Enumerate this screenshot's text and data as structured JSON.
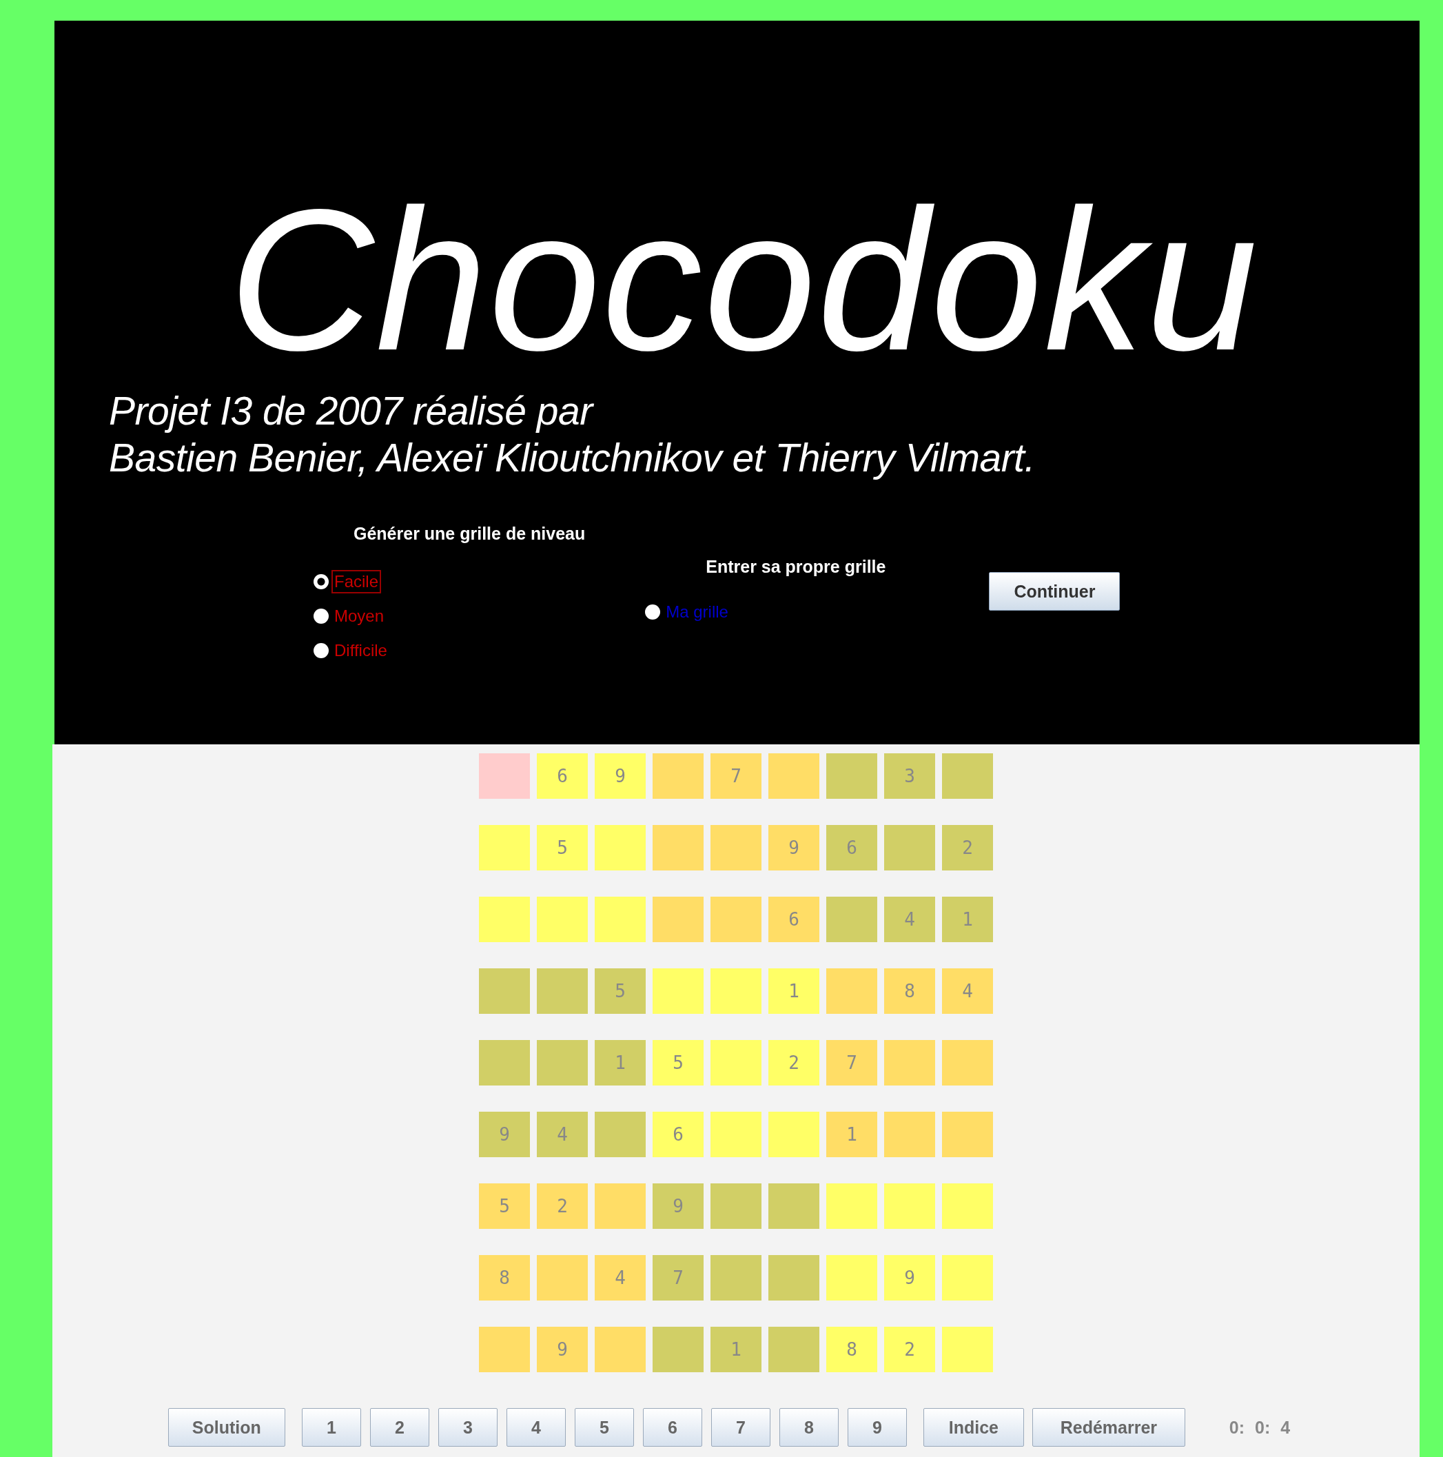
{
  "title": "Chocodoku",
  "credits": [
    "Projet I3 de 2007 réalisé par",
    "Bastien Benier, Alexeï Klioutchnikov et Thierry Vilmart."
  ],
  "generate": {
    "heading": "Générer une grille de niveau",
    "levels": [
      {
        "label": "Facile",
        "selected": true,
        "focused": true
      },
      {
        "label": "Moyen",
        "selected": false,
        "focused": false
      },
      {
        "label": "Difficile",
        "selected": false,
        "focused": false
      }
    ]
  },
  "custom": {
    "heading": "Entrer sa propre grille",
    "option": {
      "label": "Ma grille",
      "selected": false
    }
  },
  "continue_button": "Continuer",
  "grid": {
    "rows": [
      [
        {
          "selected": true
        },
        {
          "value": "6",
          "color": "#ffff66",
          "selected": false
        },
        {
          "value": "9",
          "color": "#ffff66",
          "selected": false
        },
        {
          "color": "#ffdd66",
          "selected": false
        },
        {
          "value": "7",
          "color": "#ffdd66",
          "selected": false
        },
        {
          "color": "#ffdd66",
          "selected": false
        },
        {
          "color": "#d1cf66",
          "selected": false
        },
        {
          "value": "3",
          "color": "#d1cf66",
          "selected": false
        },
        {
          "color": "#d1cf66",
          "selected": false
        }
      ],
      [
        {
          "color": "#ffff66",
          "selected": false
        },
        {
          "value": "5",
          "color": "#ffff66",
          "selected": false
        },
        {
          "color": "#ffff66",
          "selected": false
        },
        {
          "color": "#ffdd66",
          "selected": false
        },
        {
          "color": "#ffdd66",
          "selected": false
        },
        {
          "value": "9",
          "color": "#ffdd66",
          "selected": false
        },
        {
          "value": "6",
          "color": "#d1cf66",
          "selected": false
        },
        {
          "color": "#d1cf66",
          "selected": false
        },
        {
          "value": "2",
          "color": "#d1cf66",
          "selected": false
        }
      ],
      [
        {
          "color": "#ffff66",
          "selected": false
        },
        {
          "color": "#ffff66",
          "selected": false
        },
        {
          "color": "#ffff66",
          "selected": false
        },
        {
          "color": "#ffdd66",
          "selected": false
        },
        {
          "color": "#ffdd66",
          "selected": false
        },
        {
          "value": "6",
          "color": "#ffdd66",
          "selected": false
        },
        {
          "color": "#d1cf66",
          "selected": false
        },
        {
          "value": "4",
          "color": "#d1cf66",
          "selected": false
        },
        {
          "value": "1",
          "color": "#d1cf66",
          "selected": false
        }
      ],
      [
        {
          "color": "#d1cf66",
          "selected": false
        },
        {
          "color": "#d1cf66",
          "selected": false
        },
        {
          "value": "5",
          "color": "#d1cf66",
          "selected": false
        },
        {
          "color": "#ffff66",
          "selected": false
        },
        {
          "color": "#ffff66",
          "selected": false
        },
        {
          "value": "1",
          "color": "#ffff66",
          "selected": false
        },
        {
          "color": "#ffdd66",
          "selected": false
        },
        {
          "value": "8",
          "color": "#ffdd66",
          "selected": false
        },
        {
          "value": "4",
          "color": "#ffdd66",
          "selected": false
        }
      ],
      [
        {
          "color": "#d1cf66",
          "selected": false
        },
        {
          "color": "#d1cf66",
          "selected": false
        },
        {
          "value": "1",
          "color": "#d1cf66",
          "selected": false
        },
        {
          "value": "5",
          "color": "#ffff66",
          "selected": false
        },
        {
          "color": "#ffff66",
          "selected": false
        },
        {
          "value": "2",
          "color": "#ffff66",
          "selected": false
        },
        {
          "value": "7",
          "color": "#ffdd66",
          "selected": false
        },
        {
          "color": "#ffdd66",
          "selected": false
        },
        {
          "color": "#ffdd66",
          "selected": false
        }
      ],
      [
        {
          "value": "9",
          "color": "#d1cf66",
          "selected": false
        },
        {
          "value": "4",
          "color": "#d1cf66",
          "selected": false
        },
        {
          "color": "#d1cf66",
          "selected": false
        },
        {
          "value": "6",
          "color": "#ffff66",
          "selected": false
        },
        {
          "color": "#ffff66",
          "selected": false
        },
        {
          "color": "#ffff66",
          "selected": false
        },
        {
          "value": "1",
          "color": "#ffdd66",
          "selected": false
        },
        {
          "color": "#ffdd66",
          "selected": false
        },
        {
          "color": "#ffdd66",
          "selected": false
        }
      ],
      [
        {
          "value": "5",
          "color": "#ffdd66",
          "selected": false
        },
        {
          "value": "2",
          "color": "#ffdd66",
          "selected": false
        },
        {
          "color": "#ffdd66",
          "selected": false
        },
        {
          "value": "9",
          "color": "#d1cf66",
          "selected": false
        },
        {
          "color": "#d1cf66",
          "selected": false
        },
        {
          "color": "#d1cf66",
          "selected": false
        },
        {
          "color": "#ffff66",
          "selected": false
        },
        {
          "color": "#ffff66",
          "selected": false
        },
        {
          "color": "#ffff66",
          "selected": false
        }
      ],
      [
        {
          "value": "8",
          "color": "#ffdd66",
          "selected": false
        },
        {
          "color": "#ffdd66",
          "selected": false
        },
        {
          "value": "4",
          "color": "#ffdd66",
          "selected": false
        },
        {
          "value": "7",
          "color": "#d1cf66",
          "selected": false
        },
        {
          "color": "#d1cf66",
          "selected": false
        },
        {
          "color": "#d1cf66",
          "selected": false
        },
        {
          "color": "#ffff66",
          "selected": false
        },
        {
          "value": "9",
          "color": "#ffff66",
          "selected": false
        },
        {
          "color": "#ffff66",
          "selected": false
        }
      ],
      [
        {
          "color": "#ffdd66",
          "selected": false
        },
        {
          "value": "9",
          "color": "#ffdd66",
          "selected": false
        },
        {
          "color": "#ffdd66",
          "selected": false
        },
        {
          "color": "#d1cf66",
          "selected": false
        },
        {
          "value": "1",
          "color": "#d1cf66",
          "selected": false
        },
        {
          "color": "#d1cf66",
          "selected": false
        },
        {
          "value": "8",
          "color": "#ffff66",
          "selected": false
        },
        {
          "value": "2",
          "color": "#ffff66",
          "selected": false
        },
        {
          "color": "#ffff66",
          "selected": false
        }
      ]
    ]
  },
  "toolbar": {
    "solution": "Solution",
    "digits": [
      "1",
      "2",
      "3",
      "4",
      "5",
      "6",
      "7",
      "8",
      "9"
    ],
    "hint": "Indice",
    "restart": "Redémarrer",
    "timer": "0: 0: 4"
  }
}
